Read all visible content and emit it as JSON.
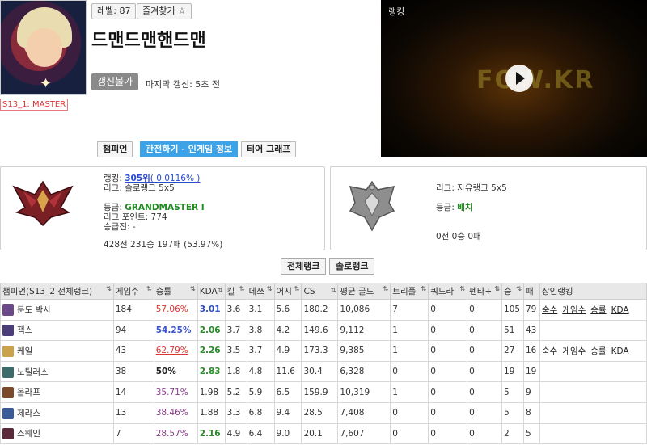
{
  "profile": {
    "level_label": "레벨: 87",
    "favorite_label": "즐겨찾기 ☆",
    "summoner_name": "드맨드맨핸드맨",
    "renew_label": "갱신불가",
    "last_update": "마지막 갱신: 5초 전",
    "season_badge": "S13_1: MASTER"
  },
  "video": {
    "label": "랭킹",
    "logo_text": "FOW.KR"
  },
  "tabs": [
    {
      "label": "챔피언",
      "active": false
    },
    {
      "label": "관전하기 - 인게임 정보",
      "active": true
    },
    {
      "label": "티어 그래프",
      "active": false
    }
  ],
  "solo_rank": {
    "ranking_prefix": "랭킹: ",
    "ranking_value": "305위",
    "ranking_pct": "( 0.0116% )",
    "league": "리그: 솔로랭크 5x5",
    "tier_prefix": "등급: ",
    "tier_value": "GRANDMASTER I",
    "points": "리그 포인트: 774",
    "promo": "승급전: -",
    "record": "428전 231승 197패 (53.97%)"
  },
  "flex_rank": {
    "league": "리그: 자유랭크 5x5",
    "tier_prefix": "등급: ",
    "tier_value": "배치",
    "record": "0전 0승 0패"
  },
  "subtabs": [
    "전체랭크",
    "솔로랭크"
  ],
  "table": {
    "headers": [
      "챔피언(S13_2 전체랭크)",
      "게임수",
      "승률",
      "KDA",
      "킬",
      "데쓰",
      "어시",
      "CS",
      "평균 골드",
      "트리플",
      "쿼드라",
      "펜타+",
      "승",
      "패",
      "장인랭킹"
    ],
    "rows": [
      {
        "champion": "문도 박사",
        "icon_color": "#6b4a8a",
        "games": "184",
        "winrate": "57.06%",
        "wr_style": "red",
        "kda": "3.01",
        "kda_style": "blue",
        "kills": "3.6",
        "deaths": "3.1",
        "assists": "5.6",
        "cs": "180.2",
        "gold": "10,086",
        "triple": "7",
        "quadra": "0",
        "penta": "0",
        "wins": "105",
        "losses": "79",
        "rank_links": [
          "숙수",
          "게임수",
          "승률",
          "KDA"
        ]
      },
      {
        "champion": "잭스",
        "icon_color": "#4a3d7a",
        "games": "94",
        "winrate": "54.25%",
        "wr_style": "blue",
        "kda": "2.06",
        "kda_style": "green",
        "kills": "3.7",
        "deaths": "3.8",
        "assists": "4.2",
        "cs": "149.6",
        "gold": "9,112",
        "triple": "1",
        "quadra": "0",
        "penta": "0",
        "wins": "51",
        "losses": "43",
        "rank_links": []
      },
      {
        "champion": "케일",
        "icon_color": "#c9a24a",
        "games": "43",
        "winrate": "62.79%",
        "wr_style": "red",
        "kda": "2.26",
        "kda_style": "green",
        "kills": "3.5",
        "deaths": "3.7",
        "assists": "4.9",
        "cs": "173.3",
        "gold": "9,385",
        "triple": "1",
        "quadra": "0",
        "penta": "0",
        "wins": "27",
        "losses": "16",
        "rank_links": [
          "숙수",
          "게임수",
          "승률",
          "KDA"
        ]
      },
      {
        "champion": "노틸러스",
        "icon_color": "#3d6a6a",
        "games": "38",
        "winrate": "50%",
        "wr_style": "bold",
        "kda": "2.83",
        "kda_style": "green",
        "kills": "1.8",
        "deaths": "4.8",
        "assists": "11.6",
        "cs": "30.4",
        "gold": "6,328",
        "triple": "0",
        "quadra": "0",
        "penta": "0",
        "wins": "19",
        "losses": "19",
        "rank_links": []
      },
      {
        "champion": "올라프",
        "icon_color": "#7a4a2a",
        "games": "14",
        "winrate": "35.71%",
        "wr_style": "purple",
        "kda": "1.98",
        "kda_style": "plain",
        "kills": "5.2",
        "deaths": "5.9",
        "assists": "6.5",
        "cs": "159.9",
        "gold": "10,319",
        "triple": "1",
        "quadra": "0",
        "penta": "0",
        "wins": "5",
        "losses": "9",
        "rank_links": []
      },
      {
        "champion": "제라스",
        "icon_color": "#3a5a9a",
        "games": "13",
        "winrate": "38.46%",
        "wr_style": "purple",
        "kda": "1.88",
        "kda_style": "plain",
        "kills": "3.3",
        "deaths": "6.8",
        "assists": "9.4",
        "cs": "28.5",
        "gold": "7,408",
        "triple": "0",
        "quadra": "0",
        "penta": "0",
        "wins": "5",
        "losses": "8",
        "rank_links": []
      },
      {
        "champion": "스웨인",
        "icon_color": "#5a2a3a",
        "games": "7",
        "winrate": "28.57%",
        "wr_style": "purple",
        "kda": "2.16",
        "kda_style": "green",
        "kills": "4.9",
        "deaths": "6.4",
        "assists": "9.0",
        "cs": "20.1",
        "gold": "7,607",
        "triple": "0",
        "quadra": "0",
        "penta": "0",
        "wins": "2",
        "losses": "5",
        "rank_links": []
      }
    ]
  }
}
